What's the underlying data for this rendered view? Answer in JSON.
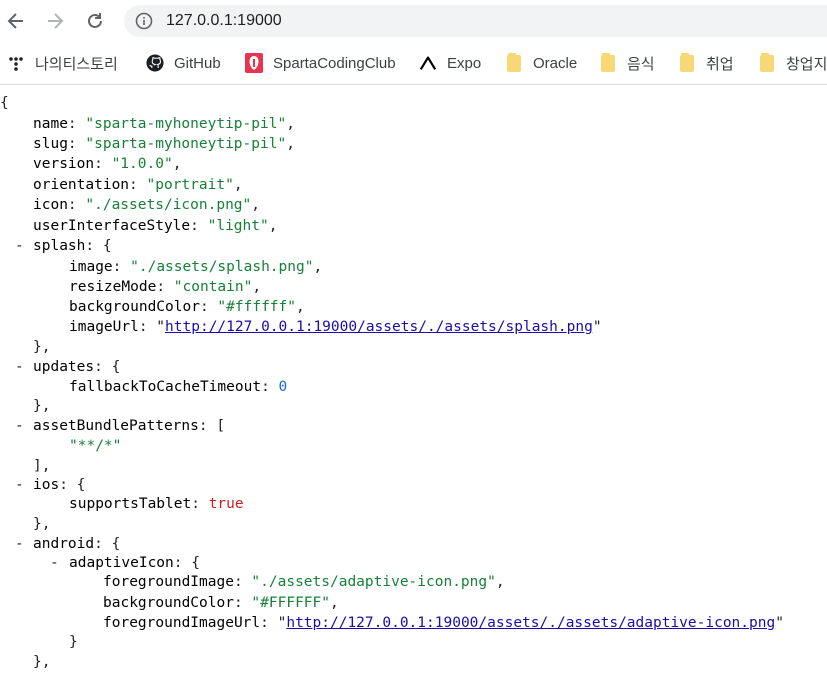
{
  "browser": {
    "url": "127.0.0.1:19000",
    "icons": {
      "back": "arrow-left-icon",
      "forward": "arrow-right-icon",
      "reload": "reload-icon",
      "info": "info-icon"
    }
  },
  "bookmarks": [
    {
      "label": "나의티스토리",
      "icon": "tistory-icon"
    },
    {
      "label": "GitHub",
      "icon": "github-icon"
    },
    {
      "label": "SpartaCodingClub",
      "icon": "sparta-icon"
    },
    {
      "label": "Expo",
      "icon": "expo-icon"
    },
    {
      "label": "Oracle",
      "icon": "folder-icon"
    },
    {
      "label": "음식",
      "icon": "folder-icon"
    },
    {
      "label": "취업",
      "icon": "folder-icon"
    },
    {
      "label": "창업지",
      "icon": "folder-icon"
    }
  ],
  "json": {
    "open_brace": "{",
    "name_key": "name",
    "name_val": "\"sparta-myhoneytip-pil\"",
    "slug_key": "slug",
    "slug_val": "\"sparta-myhoneytip-pil\"",
    "version_key": "version",
    "version_val": "\"1.0.0\"",
    "orientation_key": "orientation",
    "orientation_val": "\"portrait\"",
    "icon_key": "icon",
    "icon_val": "\"./assets/icon.png\"",
    "uistyle_key": "userInterfaceStyle",
    "uistyle_val": "\"light\"",
    "splash_key": "splash",
    "splash_image_key": "image",
    "splash_image_val": "\"./assets/splash.png\"",
    "splash_resize_key": "resizeMode",
    "splash_resize_val": "\"contain\"",
    "splash_bg_key": "backgroundColor",
    "splash_bg_val": "\"#ffffff\"",
    "splash_imgurl_key": "imageUrl",
    "splash_imgurl_val": "http://127.0.0.1:19000/assets/./assets/splash.png",
    "updates_key": "updates",
    "fallback_key": "fallbackToCacheTimeout",
    "fallback_val": "0",
    "abp_key": "assetBundlePatterns",
    "abp_item": "\"**/*\"",
    "ios_key": "ios",
    "tablet_key": "supportsTablet",
    "tablet_val": "true",
    "android_key": "android",
    "adaptive_key": "adaptiveIcon",
    "fg_key": "foregroundImage",
    "fg_val": "\"./assets/adaptive-icon.png\"",
    "abg_key": "backgroundColor",
    "abg_val": "\"#FFFFFF\"",
    "fgurl_key": "foregroundImageUrl",
    "fgurl_val": "http://127.0.0.1:19000/assets/./assets/adaptive-icon.png",
    "toggle": "-"
  }
}
